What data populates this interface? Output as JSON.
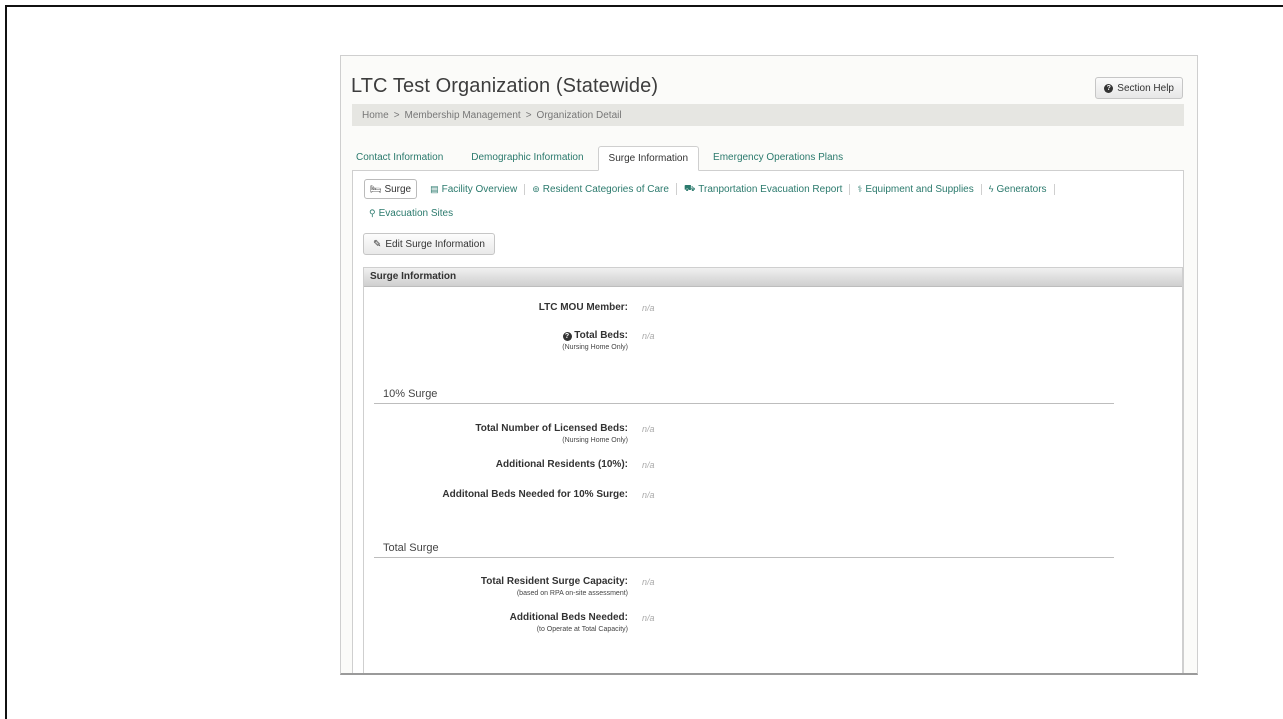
{
  "page": {
    "title": "LTC Test Organization (Statewide)",
    "help_label": "Section Help"
  },
  "breadcrumb": [
    "Home",
    ">",
    "Membership Management",
    ">",
    "Organization Detail"
  ],
  "tabs": [
    {
      "label": "Contact Information",
      "active": false
    },
    {
      "label": "Demographic Information",
      "active": false
    },
    {
      "label": "Surge Information",
      "active": true
    },
    {
      "label": "Emergency Operations Plans",
      "active": false
    }
  ],
  "subnav": [
    {
      "label": "Surge",
      "icon": "bed-icon",
      "glyph": "🛏",
      "active": true
    },
    {
      "label": "Facility Overview",
      "icon": "building-icon",
      "glyph": "▤"
    },
    {
      "label": "Resident Categories of Care",
      "icon": "users-circle-icon",
      "glyph": "⊚"
    },
    {
      "label": "Tranportation Evacuation Report",
      "icon": "truck-icon",
      "glyph": "⛟"
    },
    {
      "label": "Equipment and Supplies",
      "icon": "stethoscope-icon",
      "glyph": "⚕"
    },
    {
      "label": "Generators",
      "icon": "bolt-icon",
      "glyph": "ϟ"
    },
    {
      "label": "Evacuation Sites",
      "icon": "sitemap-icon",
      "glyph": "⚲"
    }
  ],
  "edit_button": "Edit Surge Information",
  "section": {
    "title": "Surge Information",
    "fields": [
      {
        "label": "LTC MOU Member:",
        "sub": "",
        "value": "n/a"
      },
      {
        "label": "Total Beds:",
        "sub": "(Nursing Home Only)",
        "value": "n/a"
      }
    ],
    "groups": [
      {
        "title": "10% Surge",
        "fields": [
          {
            "label": "Total Number of Licensed Beds:",
            "sub": "(Nursing Home Only)",
            "value": "n/a"
          },
          {
            "label": "Additional Residents (10%):",
            "sub": "",
            "value": "n/a"
          },
          {
            "label": "Additonal Beds Needed for 10% Surge:",
            "sub": "",
            "value": "n/a"
          }
        ]
      },
      {
        "title": "Total Surge",
        "fields": [
          {
            "label": "Total Resident Surge Capacity:",
            "sub": "(based on RPA on-site assessment)",
            "value": "n/a"
          },
          {
            "label": "Additional Beds Needed:",
            "sub": "(to Operate at Total Capacity)",
            "value": "n/a"
          }
        ]
      }
    ]
  },
  "colors": {
    "link": "#2b7a6d",
    "muted": "#aaaaaa",
    "breadcrumb_bg": "#e6e6e2"
  }
}
